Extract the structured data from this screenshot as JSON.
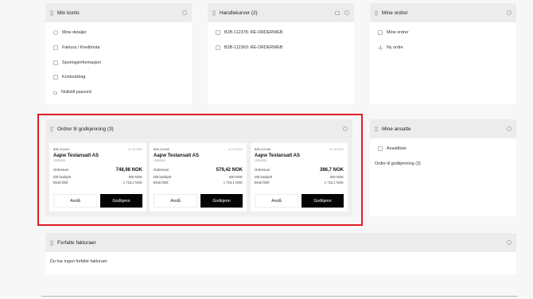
{
  "konto": {
    "title": "Min konto",
    "items": [
      "Mine detaljer",
      "Faktura / Kreditnota",
      "Sporingsinformasjon",
      "Kontoutdrag",
      "Nullstill passord"
    ]
  },
  "carts": {
    "title": "Handlekurver (2)",
    "items": [
      "B2B-112378: RE-ORDERWEB",
      "B2B-112363: RE-ORDERWEB"
    ]
  },
  "orders": {
    "title": "Mine ordrer",
    "items": [
      "Mine ordrer",
      "Ny ordre"
    ]
  },
  "approval": {
    "title": "Ordrer til godkjenning (3)",
    "cards": [
      {
        "id": "B2B-112444",
        "date": "01.10.2024",
        "company": "Aapw Testansatt AS",
        "code": "10281003",
        "sum_label": "Ordresum",
        "sum": "748,98 NOK",
        "budget_label": "Ditt budsjett",
        "budget": "500 NOK",
        "used_label": "Brukt hittil",
        "used": "1 715,1 NOK",
        "reject": "Avslå",
        "approve": "Godkjenn"
      },
      {
        "id": "B2B-112445",
        "date": "01.10.2024",
        "company": "Aapw Testansatt AS",
        "code": "10281003",
        "sum_label": "Ordresum",
        "sum": "579,42 NOK",
        "budget_label": "Ditt budsjett",
        "budget": "500 NOK",
        "used_label": "Brukt hittil",
        "used": "1 715,1 NOK",
        "reject": "Avslå",
        "approve": "Godkjenn"
      },
      {
        "id": "B2B-112446",
        "date": "01.10.2024",
        "company": "Aapw Testansatt AS",
        "code": "10281003",
        "sum_label": "Ordresum",
        "sum": "386,7 NOK",
        "budget_label": "Ditt budsjett",
        "budget": "500 NOK",
        "used_label": "Brukt hittil",
        "used": "1 715,1 NOK",
        "reject": "Avslå",
        "approve": "Godkjenn"
      }
    ]
  },
  "employees": {
    "title": "Mine ansatte",
    "list_label": "Ansattliste",
    "orders_label": "Ordre til godkjenning (3)"
  },
  "invoices": {
    "title": "Forfalte fakturaer",
    "empty": "Du har ingen forfalte fakturaer"
  }
}
